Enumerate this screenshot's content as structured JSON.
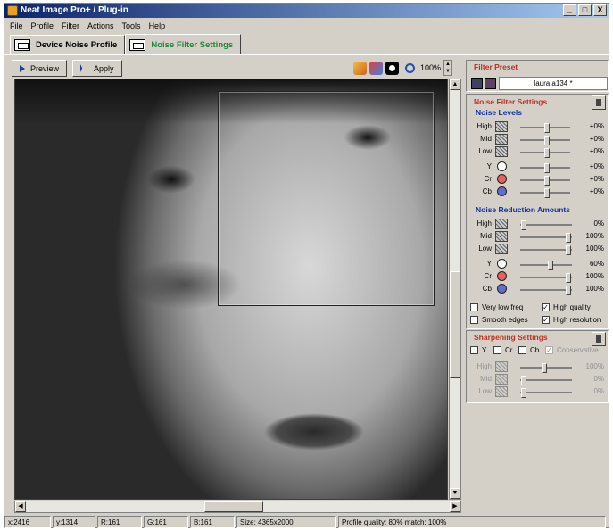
{
  "window": {
    "title": "Neat Image Pro+ / Plug-in",
    "min": "_",
    "max": "□",
    "close": "X"
  },
  "menu": [
    "File",
    "Profile",
    "Filter",
    "Actions",
    "Tools",
    "Help"
  ],
  "tabs": [
    {
      "label": "Device Noise Profile"
    },
    {
      "label": "Noise Filter Settings"
    }
  ],
  "toolbar": {
    "preview": "Preview",
    "apply": "Apply",
    "zoom": "100%"
  },
  "filter_preset": {
    "title": "Filter Preset",
    "value": "laura a134 *"
  },
  "noise_filter": {
    "title": "Noise Filter Settings",
    "levels_title": "Noise Levels",
    "levels": [
      {
        "label": "High",
        "value": "+0%",
        "pos": 0.55
      },
      {
        "label": "Mid",
        "value": "+0%",
        "pos": 0.55
      },
      {
        "label": "Low",
        "value": "+0%",
        "pos": 0.55
      },
      {
        "label": "Y",
        "value": "+0%",
        "pos": 0.55
      },
      {
        "label": "Cr",
        "value": "+0%",
        "pos": 0.55
      },
      {
        "label": "Cb",
        "value": "+0%",
        "pos": 0.55
      }
    ],
    "reduction_title": "Noise Reduction Amounts",
    "reduction": [
      {
        "label": "High",
        "value": "0%",
        "pos": 0
      },
      {
        "label": "Mid",
        "value": "100%",
        "pos": 1
      },
      {
        "label": "Low",
        "value": "100%",
        "pos": 1
      },
      {
        "label": "Y",
        "value": "60%",
        "pos": 0.6
      },
      {
        "label": "Cr",
        "value": "100%",
        "pos": 1
      },
      {
        "label": "Cb",
        "value": "100%",
        "pos": 1
      }
    ],
    "options": {
      "very_low_freq": "Very low freq",
      "smooth_edges": "Smooth edges",
      "high_quality": "High quality",
      "high_resolution": "High resolution"
    }
  },
  "sharpening": {
    "title": "Sharpening Settings",
    "y": "Y",
    "cr": "Cr",
    "cb": "Cb",
    "conservative": "Conservative",
    "rows": [
      {
        "label": "High",
        "value": "100%",
        "pos": 0.45
      },
      {
        "label": "Mid",
        "value": "0%",
        "pos": 0
      },
      {
        "label": "Low",
        "value": "0%",
        "pos": 0
      }
    ]
  },
  "status": {
    "x": "x:2416",
    "y": "y:1314",
    "r": "R:161",
    "g": "G:161",
    "b": "B:161",
    "size": "Size: 4365x2000",
    "profile": "Profile quality: 80%  match: 100%"
  },
  "colors": {
    "title_bar": "#0a246a",
    "section_red": "#c03020",
    "section_blue": "#1030a0",
    "tab_active": "#1a8a3a"
  }
}
